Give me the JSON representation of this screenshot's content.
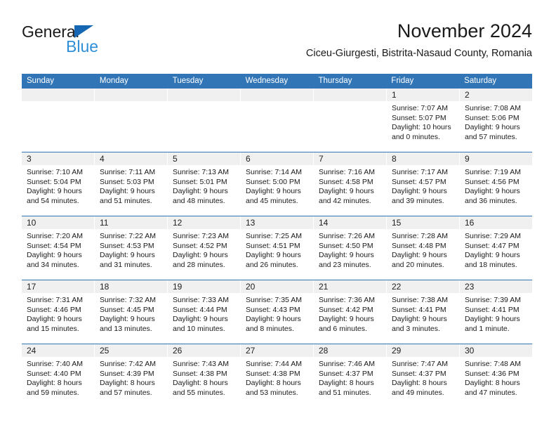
{
  "brand": {
    "name_top": "General",
    "name_bottom": "Blue",
    "triangle_color": "#1567b3",
    "blue_text_color": "#2f8fd6"
  },
  "header": {
    "title": "November 2024",
    "subtitle": "Ciceu-Giurgesti, Bistrita-Nasaud County, Romania"
  },
  "theme": {
    "header_bg": "#3175b7",
    "header_text": "#ffffff",
    "date_band_bg": "#f0f0f0",
    "cell_bg": "#ffffff",
    "text": "#1a1a1a"
  },
  "weekdays": [
    "Sunday",
    "Monday",
    "Tuesday",
    "Wednesday",
    "Thursday",
    "Friday",
    "Saturday"
  ],
  "weeks": [
    [
      {
        "day": "",
        "empty": true
      },
      {
        "day": "",
        "empty": true
      },
      {
        "day": "",
        "empty": true
      },
      {
        "day": "",
        "empty": true
      },
      {
        "day": "",
        "empty": true
      },
      {
        "day": "1",
        "sunrise": "Sunrise: 7:07 AM",
        "sunset": "Sunset: 5:07 PM",
        "daylight_1": "Daylight: 10 hours",
        "daylight_2": "and 0 minutes."
      },
      {
        "day": "2",
        "sunrise": "Sunrise: 7:08 AM",
        "sunset": "Sunset: 5:06 PM",
        "daylight_1": "Daylight: 9 hours",
        "daylight_2": "and 57 minutes."
      }
    ],
    [
      {
        "day": "3",
        "sunrise": "Sunrise: 7:10 AM",
        "sunset": "Sunset: 5:04 PM",
        "daylight_1": "Daylight: 9 hours",
        "daylight_2": "and 54 minutes."
      },
      {
        "day": "4",
        "sunrise": "Sunrise: 7:11 AM",
        "sunset": "Sunset: 5:03 PM",
        "daylight_1": "Daylight: 9 hours",
        "daylight_2": "and 51 minutes."
      },
      {
        "day": "5",
        "sunrise": "Sunrise: 7:13 AM",
        "sunset": "Sunset: 5:01 PM",
        "daylight_1": "Daylight: 9 hours",
        "daylight_2": "and 48 minutes."
      },
      {
        "day": "6",
        "sunrise": "Sunrise: 7:14 AM",
        "sunset": "Sunset: 5:00 PM",
        "daylight_1": "Daylight: 9 hours",
        "daylight_2": "and 45 minutes."
      },
      {
        "day": "7",
        "sunrise": "Sunrise: 7:16 AM",
        "sunset": "Sunset: 4:58 PM",
        "daylight_1": "Daylight: 9 hours",
        "daylight_2": "and 42 minutes."
      },
      {
        "day": "8",
        "sunrise": "Sunrise: 7:17 AM",
        "sunset": "Sunset: 4:57 PM",
        "daylight_1": "Daylight: 9 hours",
        "daylight_2": "and 39 minutes."
      },
      {
        "day": "9",
        "sunrise": "Sunrise: 7:19 AM",
        "sunset": "Sunset: 4:56 PM",
        "daylight_1": "Daylight: 9 hours",
        "daylight_2": "and 36 minutes."
      }
    ],
    [
      {
        "day": "10",
        "sunrise": "Sunrise: 7:20 AM",
        "sunset": "Sunset: 4:54 PM",
        "daylight_1": "Daylight: 9 hours",
        "daylight_2": "and 34 minutes."
      },
      {
        "day": "11",
        "sunrise": "Sunrise: 7:22 AM",
        "sunset": "Sunset: 4:53 PM",
        "daylight_1": "Daylight: 9 hours",
        "daylight_2": "and 31 minutes."
      },
      {
        "day": "12",
        "sunrise": "Sunrise: 7:23 AM",
        "sunset": "Sunset: 4:52 PM",
        "daylight_1": "Daylight: 9 hours",
        "daylight_2": "and 28 minutes."
      },
      {
        "day": "13",
        "sunrise": "Sunrise: 7:25 AM",
        "sunset": "Sunset: 4:51 PM",
        "daylight_1": "Daylight: 9 hours",
        "daylight_2": "and 26 minutes."
      },
      {
        "day": "14",
        "sunrise": "Sunrise: 7:26 AM",
        "sunset": "Sunset: 4:50 PM",
        "daylight_1": "Daylight: 9 hours",
        "daylight_2": "and 23 minutes."
      },
      {
        "day": "15",
        "sunrise": "Sunrise: 7:28 AM",
        "sunset": "Sunset: 4:48 PM",
        "daylight_1": "Daylight: 9 hours",
        "daylight_2": "and 20 minutes."
      },
      {
        "day": "16",
        "sunrise": "Sunrise: 7:29 AM",
        "sunset": "Sunset: 4:47 PM",
        "daylight_1": "Daylight: 9 hours",
        "daylight_2": "and 18 minutes."
      }
    ],
    [
      {
        "day": "17",
        "sunrise": "Sunrise: 7:31 AM",
        "sunset": "Sunset: 4:46 PM",
        "daylight_1": "Daylight: 9 hours",
        "daylight_2": "and 15 minutes."
      },
      {
        "day": "18",
        "sunrise": "Sunrise: 7:32 AM",
        "sunset": "Sunset: 4:45 PM",
        "daylight_1": "Daylight: 9 hours",
        "daylight_2": "and 13 minutes."
      },
      {
        "day": "19",
        "sunrise": "Sunrise: 7:33 AM",
        "sunset": "Sunset: 4:44 PM",
        "daylight_1": "Daylight: 9 hours",
        "daylight_2": "and 10 minutes."
      },
      {
        "day": "20",
        "sunrise": "Sunrise: 7:35 AM",
        "sunset": "Sunset: 4:43 PM",
        "daylight_1": "Daylight: 9 hours",
        "daylight_2": "and 8 minutes."
      },
      {
        "day": "21",
        "sunrise": "Sunrise: 7:36 AM",
        "sunset": "Sunset: 4:42 PM",
        "daylight_1": "Daylight: 9 hours",
        "daylight_2": "and 6 minutes."
      },
      {
        "day": "22",
        "sunrise": "Sunrise: 7:38 AM",
        "sunset": "Sunset: 4:41 PM",
        "daylight_1": "Daylight: 9 hours",
        "daylight_2": "and 3 minutes."
      },
      {
        "day": "23",
        "sunrise": "Sunrise: 7:39 AM",
        "sunset": "Sunset: 4:41 PM",
        "daylight_1": "Daylight: 9 hours",
        "daylight_2": "and 1 minute."
      }
    ],
    [
      {
        "day": "24",
        "sunrise": "Sunrise: 7:40 AM",
        "sunset": "Sunset: 4:40 PM",
        "daylight_1": "Daylight: 8 hours",
        "daylight_2": "and 59 minutes."
      },
      {
        "day": "25",
        "sunrise": "Sunrise: 7:42 AM",
        "sunset": "Sunset: 4:39 PM",
        "daylight_1": "Daylight: 8 hours",
        "daylight_2": "and 57 minutes."
      },
      {
        "day": "26",
        "sunrise": "Sunrise: 7:43 AM",
        "sunset": "Sunset: 4:38 PM",
        "daylight_1": "Daylight: 8 hours",
        "daylight_2": "and 55 minutes."
      },
      {
        "day": "27",
        "sunrise": "Sunrise: 7:44 AM",
        "sunset": "Sunset: 4:38 PM",
        "daylight_1": "Daylight: 8 hours",
        "daylight_2": "and 53 minutes."
      },
      {
        "day": "28",
        "sunrise": "Sunrise: 7:46 AM",
        "sunset": "Sunset: 4:37 PM",
        "daylight_1": "Daylight: 8 hours",
        "daylight_2": "and 51 minutes."
      },
      {
        "day": "29",
        "sunrise": "Sunrise: 7:47 AM",
        "sunset": "Sunset: 4:37 PM",
        "daylight_1": "Daylight: 8 hours",
        "daylight_2": "and 49 minutes."
      },
      {
        "day": "30",
        "sunrise": "Sunrise: 7:48 AM",
        "sunset": "Sunset: 4:36 PM",
        "daylight_1": "Daylight: 8 hours",
        "daylight_2": "and 47 minutes."
      }
    ]
  ]
}
